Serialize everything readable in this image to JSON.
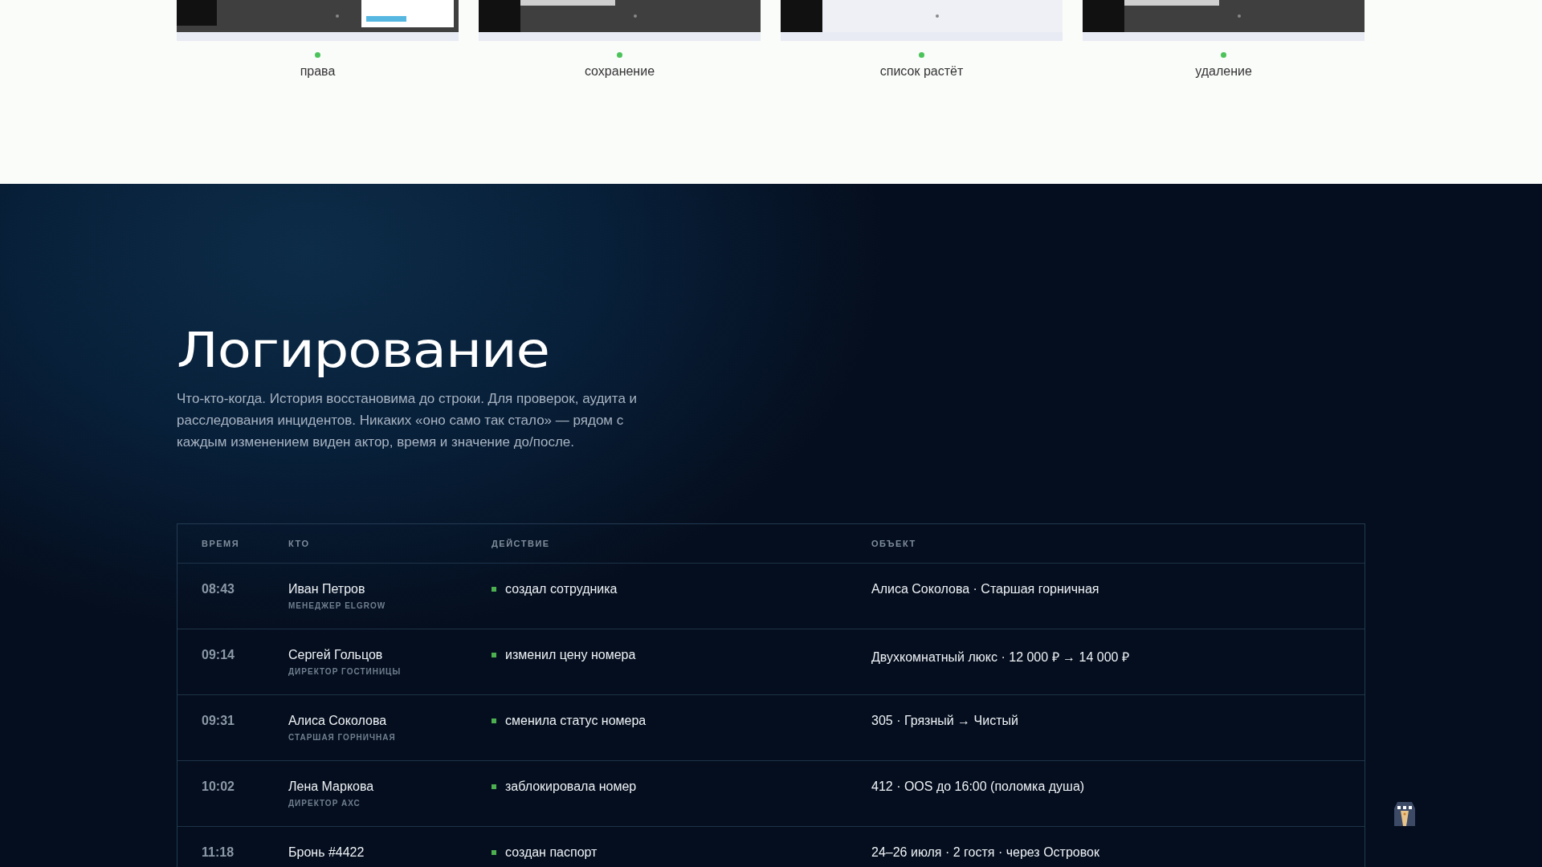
{
  "gallery": [
    {
      "caption": "права"
    },
    {
      "caption": "сохранение"
    },
    {
      "caption": "список растёт"
    },
    {
      "caption": "удаление"
    }
  ],
  "section": {
    "title": "Логирование",
    "description": "Что-кто-когда. История восстановима до строки. Для проверок, аудита и расследования инцидентов. Никаких «оно само так стало» — рядом с каждым изменением виден актор, время и значение до/после."
  },
  "table": {
    "columns": [
      "ВРЕМЯ",
      "КТО",
      "ДЕЙСТВИЕ",
      "ОБЪЕКТ"
    ],
    "rows": [
      {
        "time": "08:43",
        "who": "Иван Петров",
        "role": "МЕНЕДЖЕР ELGROW",
        "action": "создал сотрудника",
        "object": "Алиса Соколова · Старшая горничная",
        "color": "#4caf50"
      },
      {
        "time": "09:14",
        "who": "Сергей Гольцов",
        "role": "ДИРЕКТОР ГОСТИНИЦЫ",
        "action": "изменил цену номера",
        "object": "Двухкомнатный люкс · 12 000 ₽ → 14 000 ₽",
        "color": "#4caf50"
      },
      {
        "time": "09:31",
        "who": "Алиса Соколова",
        "role": "СТАРШАЯ ГОРНИЧНАЯ",
        "action": "сменила статус номера",
        "object": "305 · Грязный → Чистый",
        "color": "#4caf50"
      },
      {
        "time": "10:02",
        "who": "Лена Маркова",
        "role": "ДИРЕКТОР АХС",
        "action": "заблокировала номер",
        "object": "412 · OOS до 16:00 (поломка душа)",
        "color": "#4caf50"
      },
      {
        "time": "11:18",
        "who": "Бронь #4422",
        "action": "создан паспорт",
        "object": "24–26 июля · 2 гостя · через Островок",
        "color": "#4caf50"
      }
    ]
  }
}
